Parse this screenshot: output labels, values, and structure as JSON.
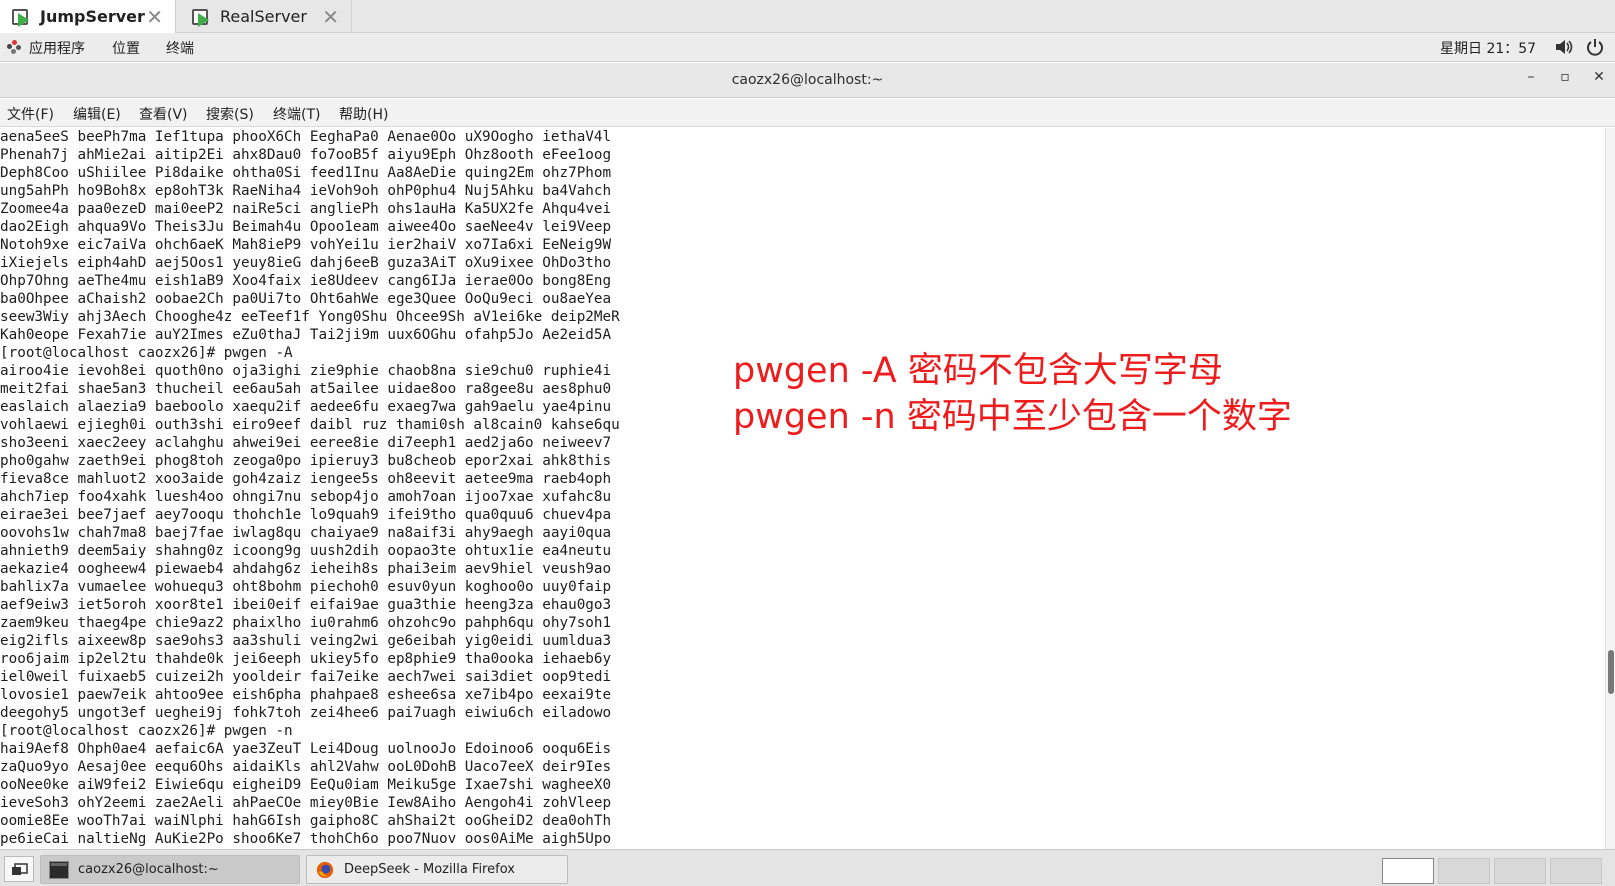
{
  "tabs": [
    {
      "label": "JumpServer",
      "active": true
    },
    {
      "label": "RealServer",
      "active": false
    }
  ],
  "top_panel": {
    "applications": "应用程序",
    "places": "位置",
    "terminal": "终端",
    "clock": "星期日 21：57"
  },
  "window": {
    "title": "caozx26@localhost:~",
    "minimize": "–",
    "maximize": "▫",
    "close": "✕"
  },
  "menubar": {
    "file": "文件(F)",
    "edit": "编辑(E)",
    "view": "查看(V)",
    "search": "搜索(S)",
    "terminal": "终端(T)",
    "help": "帮助(H)"
  },
  "terminal_lines": [
    "aena5eeS beePh7ma Ief1tupa phooX6Ch EeghaPa0 Aenae0Oo uX9Oogho iethaV4l",
    "Phenah7j ahMie2ai aitip2Ei ahx8Dau0 fo7ooB5f aiyu9Eph Ohz8ooth eFee1oog",
    "Deph8Coo uShiilee Pi8daike ohtha0Si feed1Inu Aa8AeDie quing2Em ohz7Phom",
    "ung5ahPh ho9Boh8x ep8ohT3k RaeNiha4 ieVoh9oh ohP0phu4 Nuj5Ahku ba4Vahch",
    "Zoomee4a paa0ezeD mai0eeP2 naiRe5ci angliePh ohs1auHa Ka5UX2fe Ahqu4vei",
    "dao2Eigh ahqua9Vo Theis3Ju Beimah4u Opoo1eam aiwee4Oo saeNee4v lei9Veep",
    "Notoh9xe eic7aiVa ohch6aeK Mah8ieP9 vohYei1u ier2haiV xo7Ia6xi EeNeig9W",
    "iXiejels eiph4ahD aej5Oos1 yeuy8ieG dahj6eeB guza3AiT oXu9ixee OhDo3tho",
    "Ohp7Ohng aeThe4mu eish1aB9 Xoo4faix ie8Udeev cang6IJa ierae0Oo bong8Eng",
    "ba0Ohpee aChaish2 oobae2Ch pa0Ui7to Oht6ahWe ege3Quee OoQu9eci ou8aeYea",
    "seew3Wiy ahj3Aech Chooghe4z eeTeef1f Yong0Shu Ohcee9Sh aV1ei6ke deip2MeR",
    "Kah0eope Fexah7ie auY2Imes eZu0thaJ Tai2ji9m uux6OGhu ofahp5Jo Ae2eid5A",
    "[root@localhost caozx26]# pwgen -A",
    "airoo4ie ievoh8ei quoth0no oja3ighi zie9phie chaob8na sie9chu0 ruphie4i",
    "meit2fai shae5an3 thucheil ee6au5ah at5ailee uidae8oo ra8gee8u aes8phu0",
    "easlaich alaezia9 baeboolo xaequ2if aedee6fu exaeg7wa gah9aelu yae4pinu",
    "vohlaewi ejiegh0i outh3shi eiro9eef daibl ruz thami0sh al8cain0 kahse6qu",
    "sho3eeni xaec2eey aclahghu ahwei9ei eeree8ie di7eeph1 aed2ja6o neiweev7",
    "pho0gahw zaeth9ei phog8toh zeoga0po ipieruy3 bu8cheob epor2xai ahk8this",
    "fieva8ce mahluot2 xoo3aide goh4zaiz iengee5s oh8eevit aetee9ma raeb4oph",
    "ahch7iep foo4xahk luesh4oo ohngi7nu sebop4jo amoh7oan ijoo7xae xufahc8u",
    "eirae3ei bee7jaef aey7ooqu thohch1e lo9quah9 ifei9tho qua0quu6 chuev4pa",
    "oovohs1w chah7ma8 baej7fae iwlag8qu chaiyae9 na8aif3i ahy9aegh aayi0qua",
    "ahnieth9 deem5aiy shahng0z icoong9g uush2dih oopao3te ohtux1ie ea4neutu",
    "aekazie4 oogheew4 piewaeb4 ahdahg6z ieheih8s phai3eim aev9hiel veush9ao",
    "bahlix7a vumaelee wohuequ3 oht8bohm piechoh0 esuv0yun koghoo0o uuy0faip",
    "aef9eiw3 iet5oroh xoor8te1 ibei0eif eifai9ae gua3thie heeng3za ehau0go3",
    "zaem9keu thaeg4pe chie9az2 phaixlho iu0rahm6 ohzohc9o pahph6qu ohy7soh1",
    "eig2ifls aixeew8p sae9ohs3 aa3shuli veing2wi ge6eibah yig0eidi uumldua3",
    "roo6jaim ip2el2tu thahde0k jei6eeph ukiey5fo ep8phie9 tha0ooka iehaeb6y",
    "iel0weil fuixaeb5 cuizei2h yooldeir fai7eike aech7wei sai3diet oop9tedi",
    "lovosie1 paew7eik ahtoo9ee eish6pha phahpae8 eshee6sa xe7ib4po eexai9te",
    "deegohy5 ungot3ef ueghei9j fohk7toh zei4hee6 pai7uagh eiwiu6ch eiladowo",
    "[root@localhost caozx26]# pwgen -n",
    "hai9Aef8 Ohph0ae4 aefaic6A yae3ZeuT Lei4Doug uolnooJo Edoinoo6 ooqu6Eis",
    "zaQuo9yo Aesaj0ee eequ6Ohs aidaiKls ahl2Vahw ooL0DohB Uaco7eeX deir9Ies",
    "ooNee0ke aiW9fei2 Eiwie6qu eigheiD9 EeQu0iam Meiku5ge Ixae7shi wagheeX0",
    "ieveSoh3 ohY2eemi zae2Aeli ahPaeCOe miey0Bie Iew8Aiho Aengoh4i zohVleep",
    "oomie8Ee wooTh7ai waiNlphi hahG6Ish gaipho8C ahShai2t ooGheiD2 dea0ohTh",
    "pe6ieCai naltieNg AuKie2Po shoo6Ke7 thohCh6o poo7Nuov oos0AiMe aigh5Upo"
  ],
  "annotations": [
    "pwgen -A 密码不包含大写字母",
    "pwgen -n 密码中至少包含一个数字"
  ],
  "taskbar": {
    "terminal_task": "caozx26@localhost:~",
    "firefox_task": "DeepSeek - Mozilla Firefox"
  },
  "colors": {
    "annotation": "#ee1c1c",
    "tab_icon_play": "#3fae49",
    "firefox_orange": "#e66000"
  }
}
